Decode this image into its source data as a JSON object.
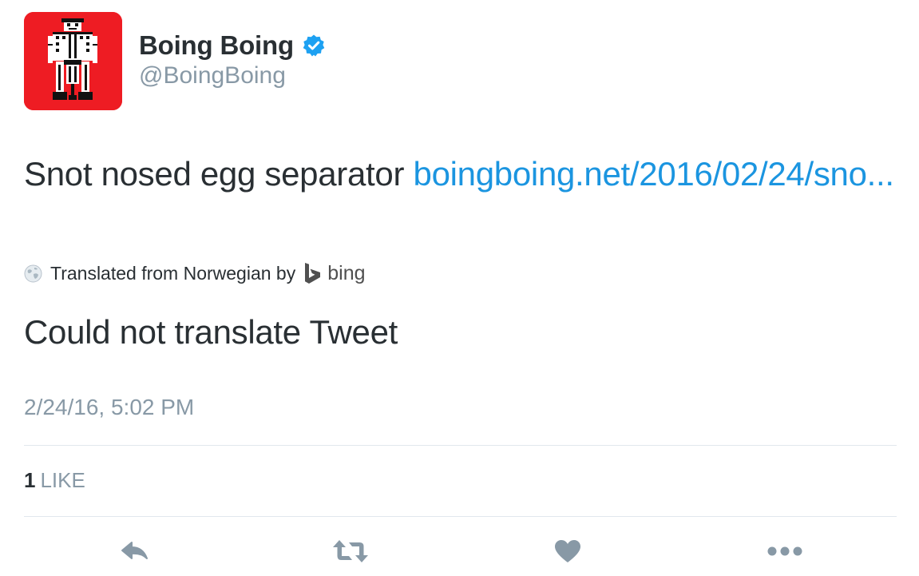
{
  "author": {
    "display_name": "Boing Boing",
    "handle": "@BoingBoing",
    "verified": true,
    "avatar_icon": "boingboing-jackhammer-logo",
    "avatar_color": "#ee1c23"
  },
  "tweet": {
    "text": "Snot nosed egg separator ",
    "link_text": "boingboing.net/2016/02/24/sno...",
    "translation": {
      "label": "Translated from Norwegian by",
      "provider": "bing",
      "globe_icon": "globe-icon",
      "result": "Could not translate Tweet"
    },
    "timestamp": "2/24/16, 5:02 PM"
  },
  "stats": {
    "likes_count": "1",
    "likes_label": "LIKE"
  },
  "actions": {
    "reply_icon": "reply-icon",
    "retweet_icon": "retweet-icon",
    "like_icon": "heart-icon",
    "more_icon": "more-dots-icon"
  },
  "colors": {
    "text": "#292f33",
    "secondary": "#8899a6",
    "link": "#1b95e0",
    "verified": "#1da1f2",
    "divider": "#e1e8ed"
  }
}
